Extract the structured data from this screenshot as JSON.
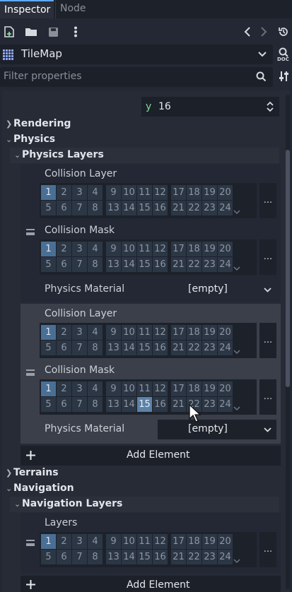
{
  "tabs": [
    {
      "label": "Inspector"
    },
    {
      "label": "Node"
    }
  ],
  "toolbar": {
    "icons": [
      "new-resource-icon",
      "open-folder-icon",
      "save-icon",
      "more-vert-icon",
      "history-back-icon",
      "history-forward-icon",
      "object-history-icon"
    ]
  },
  "object_selector": {
    "value": "TileMap",
    "doc_label": "DOC"
  },
  "filter": {
    "placeholder": "Filter properties"
  },
  "y_field": {
    "axis": "y",
    "value": "16"
  },
  "sections": {
    "rendering": "Rendering",
    "physics": "Physics",
    "physics_layers": "Physics Layers",
    "terrains": "Terrains",
    "navigation": "Navigation",
    "navigation_layers": "Navigation Layers"
  },
  "layer_numbers": {
    "row1": [
      "1",
      "2",
      "3",
      "4",
      "9",
      "10",
      "11",
      "12",
      "17",
      "18",
      "19",
      "20"
    ],
    "row2": [
      "5",
      "6",
      "7",
      "8",
      "13",
      "14",
      "15",
      "16",
      "21",
      "22",
      "23",
      "24"
    ]
  },
  "physics_elements": [
    {
      "collision_layer_label": "Collision Layer",
      "collision_mask_label": "Collision Mask",
      "material_label": "Physics Material",
      "material_value": "[empty]",
      "layer_on": [
        "1"
      ],
      "mask_on": [
        "1"
      ]
    },
    {
      "collision_layer_label": "Collision Layer",
      "collision_mask_label": "Collision Mask",
      "material_label": "Physics Material",
      "material_value": "[empty]",
      "layer_on": [
        "1"
      ],
      "mask_on": [
        "1"
      ],
      "mask_hover": [
        "15"
      ]
    }
  ],
  "add_element_label": "Add Element",
  "navigation_element": {
    "layers_label": "Layers",
    "layers_on": [
      "1"
    ]
  },
  "add_element_label_2": "Add Element",
  "more_label": "...",
  "colors": {
    "accent": "#5fa8ff",
    "layer_on": "#4a6f95",
    "layer_off": "#2c3746",
    "panel": "#262b36"
  }
}
